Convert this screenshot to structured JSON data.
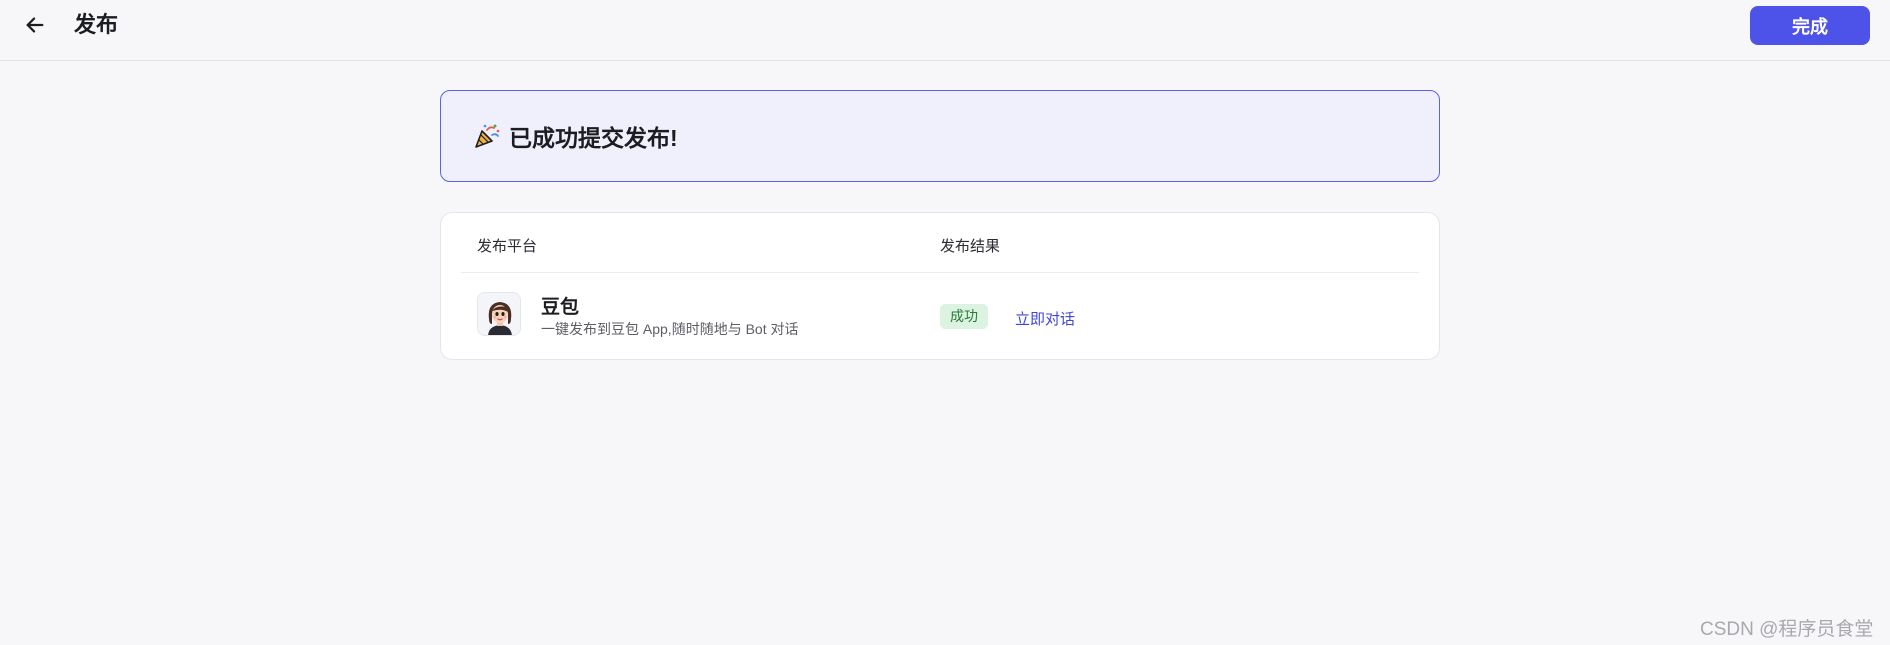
{
  "header": {
    "title": "发布",
    "done_label": "完成",
    "back_icon": "arrow-left-icon"
  },
  "banner": {
    "icon": "party-popper-icon",
    "text": "已成功提交发布!"
  },
  "results_table": {
    "columns": [
      "发布平台",
      "发布结果"
    ],
    "rows": [
      {
        "platform_name": "豆包",
        "platform_desc": "一键发布到豆包 App,随时随地与 Bot 对话",
        "status": "成功",
        "action": "立即对话"
      }
    ]
  },
  "watermark": "CSDN @程序员食堂",
  "colors": {
    "accent": "#4d53e8",
    "banner_bg": "#eff0fc",
    "success_bg": "#dcf3e1",
    "success_text": "#2a7a3a"
  }
}
